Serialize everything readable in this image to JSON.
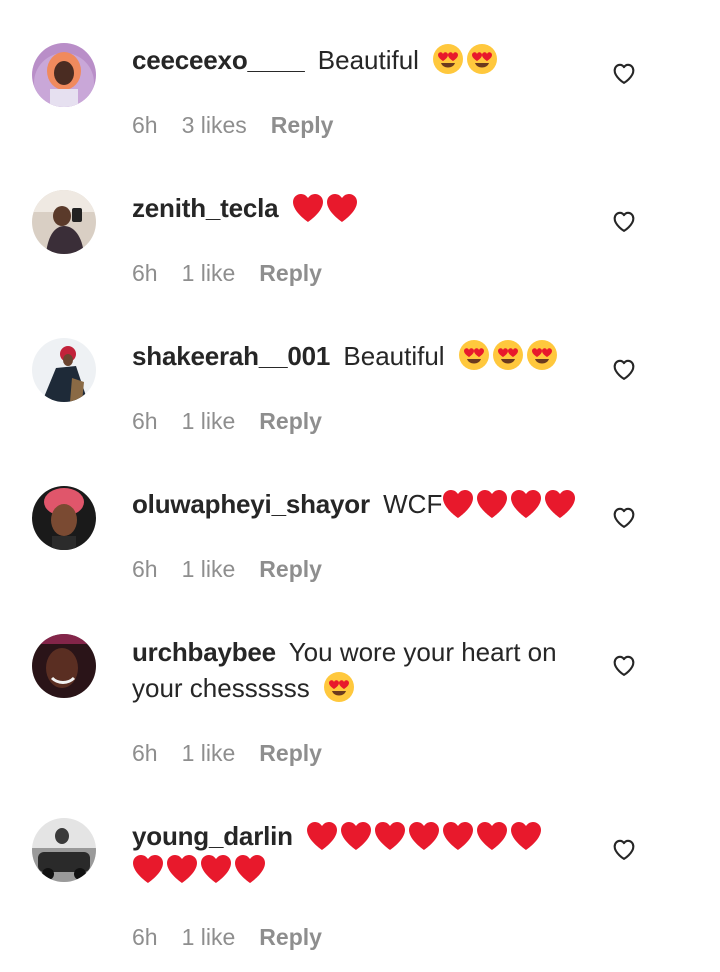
{
  "comments": [
    {
      "username": "ceeceexo____",
      "text": "Beautiful",
      "emojis": [
        "heart-eyes",
        "heart-eyes"
      ],
      "time": "6h",
      "likes": "3 likes",
      "reply": "Reply",
      "avatar": "avatar-pink-hair"
    },
    {
      "username": "zenith_tecla",
      "text": "",
      "emojis": [
        "red-heart",
        "red-heart"
      ],
      "time": "6h",
      "likes": "1 like",
      "reply": "Reply",
      "avatar": "avatar-mirror-selfie"
    },
    {
      "username": "shakeerah__001",
      "text": "Beautiful",
      "emojis": [
        "heart-eyes",
        "heart-eyes",
        "heart-eyes"
      ],
      "time": "6h",
      "likes": "1 like",
      "reply": "Reply",
      "avatar": "avatar-red-cap"
    },
    {
      "username": "oluwapheyi_shayor",
      "text": "WCF",
      "emojis": [
        "red-heart",
        "red-heart",
        "red-heart",
        "red-heart"
      ],
      "time": "6h",
      "likes": "1 like",
      "reply": "Reply",
      "avatar": "avatar-headwrap"
    },
    {
      "username": "urchbaybee",
      "text": "You wore your heart on your chessssss",
      "emojis": [
        "heart-eyes"
      ],
      "time": "6h",
      "likes": "1 like",
      "reply": "Reply",
      "avatar": "avatar-smile"
    },
    {
      "username": "young_darlin",
      "text": "",
      "emojis": [
        "red-heart",
        "red-heart",
        "red-heart",
        "red-heart",
        "red-heart",
        "red-heart",
        "red-heart",
        "red-heart",
        "red-heart",
        "red-heart",
        "red-heart"
      ],
      "time": "6h",
      "likes": "1 like",
      "reply": "Reply",
      "avatar": "avatar-car-bw"
    }
  ],
  "colors": {
    "text": "#262626",
    "meta": "#8e8e8e",
    "heart_red": "#e8192c",
    "emoji_yellow": "#ffc83d"
  },
  "icons": {
    "like": "heart-outline-icon",
    "heart_eyes": "heart-eyes-emoji",
    "red_heart": "red-heart-emoji"
  }
}
